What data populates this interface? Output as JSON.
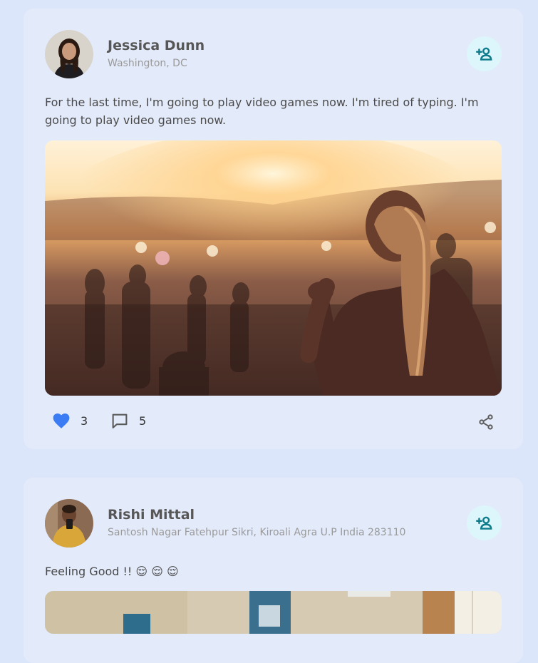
{
  "posts": [
    {
      "author": "Jessica Dunn",
      "location": "Washington, DC",
      "text": "For the last time, I'm going to play video games now. I'm tired of typing. I'm going to play video games now.",
      "likes": "3",
      "comments": "5"
    },
    {
      "author": "Rishi Mittal",
      "location": "Santosh Nagar Fatehpur Sikri, Kiroali Agra U.P India 283110",
      "text": "Feeling Good !! 😌 😌 😌"
    }
  ],
  "colors": {
    "background": "#dce6fa",
    "card": "#e3eafa",
    "accent_teal": "#0f7c8c",
    "like_blue": "#3b7cf5"
  },
  "icons": {
    "follow": "add-user-icon",
    "like": "heart-icon",
    "comment": "comment-icon",
    "share": "share-icon"
  }
}
